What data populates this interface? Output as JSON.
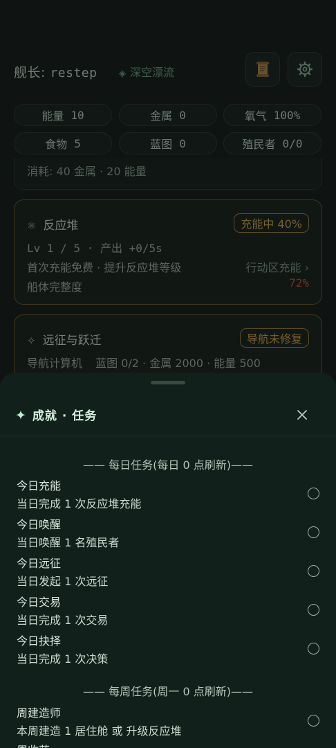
{
  "header": {
    "captain_label": "舰长:",
    "captain_name": "restep",
    "status_icon": "radar-icon",
    "status_text": "深空漂流",
    "log_icon": "scroll-icon",
    "settings_icon": "gear-icon"
  },
  "resources": [
    {
      "label": "能量",
      "value": "10"
    },
    {
      "label": "金属",
      "value": "0"
    },
    {
      "label": "氧气",
      "value": "100%"
    },
    {
      "label": "食物",
      "value": "5"
    },
    {
      "label": "蓝图",
      "value": "0"
    },
    {
      "label": "殖民者",
      "value": "0/0"
    }
  ],
  "top_card": {
    "cost_text": "消耗: 40 金属 · 20 能量"
  },
  "reactor": {
    "icon": "atom-icon",
    "title": "反应堆",
    "badge": "充能中 40%",
    "level_text": "Lv 1 / 5 · 产出 +0/5s",
    "hint_text": "首次充能免费 · 提升反应堆等级",
    "action_text": "行动区充能 ›",
    "hull_label": "船体完整度",
    "hull_value": "72%"
  },
  "expedition": {
    "icon": "sparkle-icon",
    "title": "远征与跃迁",
    "badge": "导航未修复",
    "req_label": "导航计算机",
    "req_text": "蓝图 0/2 · 金属 2000 · 能量 500"
  },
  "sheet": {
    "title_icon": "star-icon",
    "title": "成就 · 任务",
    "close_icon": "close-icon",
    "daily_title": "—— 每日任务(每日 0 点刷新)——",
    "daily_tasks": [
      {
        "name": "今日充能",
        "desc": "当日完成 1 次反应堆充能"
      },
      {
        "name": "今日唤醒",
        "desc": "当日唤醒 1 名殖民者"
      },
      {
        "name": "今日远征",
        "desc": "当日发起 1 次远征"
      },
      {
        "name": "今日交易",
        "desc": "当日完成 1 次交易"
      },
      {
        "name": "今日抉择",
        "desc": "当日完成 1 次决策"
      }
    ],
    "weekly_title": "—— 每周任务(周一 0 点刷新)——",
    "weekly_tasks": [
      {
        "name": "周建造师",
        "desc": "本周建造 1 居住舱 或 升级反应堆"
      },
      {
        "name": "周收获",
        "desc": ""
      }
    ]
  },
  "colors": {
    "accent_gold": "#d2a54a",
    "accent_green": "#bff0cf",
    "danger": "#c0504a"
  }
}
